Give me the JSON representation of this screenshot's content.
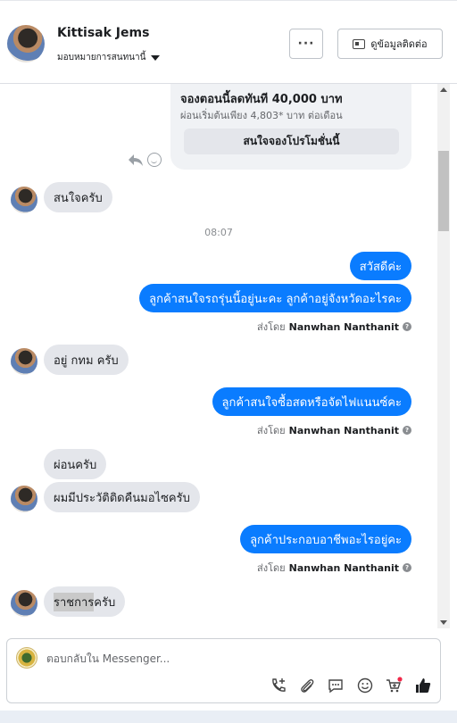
{
  "header": {
    "contact_name": "Kittisak Jems",
    "assign_label": "มอบหมายการสนทนานี้",
    "more_label": "···",
    "contact_info_label": "ดูข้อมูลติดต่อ"
  },
  "promo_card": {
    "title": "จองตอนนี้ลดทันที 40,000 บาท",
    "subtitle": "ผ่อนเริ่มต้นเพียง 4,803* บาท ต่อเดือน",
    "button_label": "สนใจจองโปรโมชั่นนี้"
  },
  "messages": [
    {
      "side": "in",
      "text": "สนใจครับ"
    },
    {
      "side": "time",
      "text": "08:07"
    },
    {
      "side": "out",
      "text": "สวัสดีค่ะ"
    },
    {
      "side": "out",
      "text": "ลูกค้าสนใจรถรุ่นนี้อยู่นะคะ ลูกค้าอยู่จังหวัดอะไรคะ"
    },
    {
      "side": "out-meta",
      "prefix": "ส่งโดย",
      "agent": "Nanwhan Nanthanit"
    },
    {
      "side": "in",
      "text": "อยู่ กทม ครับ"
    },
    {
      "side": "out",
      "text": "ลูกค้าสนใจซื้อสดหรือจัดไฟแนนซ์คะ"
    },
    {
      "side": "out-meta",
      "prefix": "ส่งโดย",
      "agent": "Nanwhan Nanthanit"
    },
    {
      "side": "in",
      "text": "ผ่อนครับ"
    },
    {
      "side": "in",
      "text": "ผมมีประวัติติดคืนมอไซครับ"
    },
    {
      "side": "out",
      "text": "ลูกค้าประกอบอาชีพอะไรอยู่คะ"
    },
    {
      "side": "out-meta",
      "prefix": "ส่งโดย",
      "agent": "Nanwhan Nanthanit"
    },
    {
      "side": "in",
      "text_highlight": "ราชการ",
      "text_rest": "ครับ"
    }
  ],
  "composer": {
    "placeholder": "ตอบกลับใน Messenger...",
    "value": ""
  },
  "colors": {
    "outgoing_bubble": "#0a7cff",
    "incoming_bubble": "#e4e6eb",
    "notification_dot": "#f02849"
  },
  "icons": [
    "reply-icon",
    "emoji-icon",
    "call-add-icon",
    "attachment-icon",
    "saved-replies-icon",
    "emoji-icon",
    "shop-cart-icon",
    "like-icon"
  ]
}
